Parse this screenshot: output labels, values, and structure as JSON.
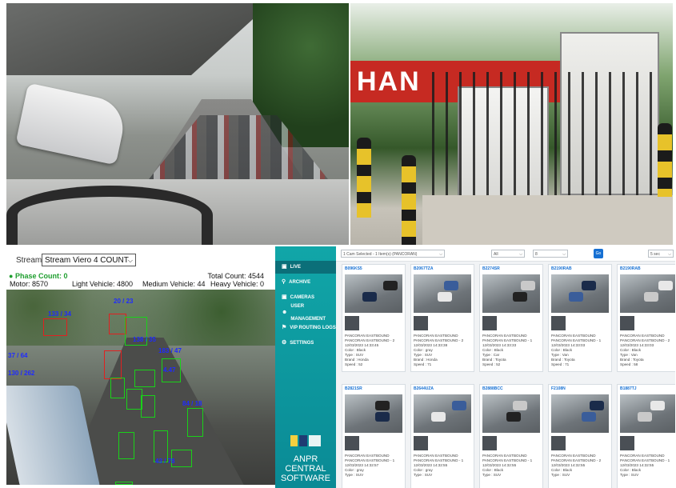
{
  "photo_top_right": {
    "banner_text": "HAN"
  },
  "counter_app": {
    "stream_label": "Stream",
    "stream_value": "Stream Viero 4 COUNT",
    "phase_count": "Phase Count: 0",
    "motor": "Motor: 8570",
    "light_vehicle": "Light Vehicle: 4800",
    "medium_vehicle": "Medium Vehicle: 44",
    "total_count": "Total Count: 4544",
    "heavy_vehicle": "Heavy Vehicle: 0",
    "detection_labels": [
      "133 / 34",
      "20 / 23",
      "138 / 35",
      "37 / 64",
      "130 / 262",
      "183 / 47",
      "4.47",
      "84 / 18",
      "43 / 78"
    ]
  },
  "anpr": {
    "nav": [
      {
        "icon": "live-icon",
        "label": "LIVE"
      },
      {
        "icon": "archive-icon",
        "label": "ARCHIVE"
      },
      {
        "icon": "camera-icon",
        "label": "CAMERAS"
      },
      {
        "icon": "user-icon",
        "label": "USER MANAGEMENT"
      },
      {
        "icon": "logs-icon",
        "label": "VIP ROUTING LOGS"
      },
      {
        "icon": "gear-icon",
        "label": "SETTINGS"
      }
    ],
    "brand_line1": "ANPR",
    "brand_line2": "CENTRAL",
    "brand_line3": "SOFTWARE",
    "filter_camera": "1 Cam Selected - 1 Item(s) (PANCORAN)",
    "filter_all": "All",
    "filter_count": "8",
    "filter_button": "Go",
    "filter_right": "5 sec",
    "cards": [
      {
        "plate": "B096KS5",
        "location": "PANCORAN EASTBOUND",
        "camera": "PANCORAN EASTBOUND - 2",
        "time": "12/03/2023 14:33:45",
        "color": "Color : Black",
        "type": "Type : SUV",
        "brand": "Brand : Honda",
        "speed": "Speed : 52"
      },
      {
        "plate": "B2067TZA",
        "location": "PANCORAN EASTBOUND",
        "camera": "PANCORAN EASTBOUND - 2",
        "time": "12/03/2023 14:33:38",
        "color": "Color : gray",
        "type": "Type : SUV",
        "brand": "Brand : Honda",
        "speed": "Speed : 71"
      },
      {
        "plate": "B2274SR",
        "location": "PANCORAN EASTBOUND",
        "camera": "PANCORAN EASTBOUND - 1",
        "time": "12/03/2023 14:33:33",
        "color": "Color : Black",
        "type": "Type : Car",
        "brand": "Brand : Toyota",
        "speed": "Speed : 52"
      },
      {
        "plate": "B2190RAB",
        "location": "PANCORAN EASTBOUND",
        "camera": "PANCORAN EASTBOUND - 1",
        "time": "12/03/2023 14:33:03",
        "color": "Color : Black",
        "type": "Type : Van",
        "brand": "Brand : Toyota",
        "speed": "Speed : 71"
      },
      {
        "plate": "B2190RAB",
        "location": "PANCORAN EASTBOUND",
        "camera": "PANCORAN EASTBOUND - 2",
        "time": "12/03/2023 14:33:03",
        "color": "Color : Black",
        "type": "Type : Van",
        "brand": "Brand : Toyota",
        "speed": "Speed : 58"
      },
      {
        "plate": "B2821SR",
        "location": "PANCORAN EASTBOUND",
        "camera": "PANCORAN EASTBOUND - 1",
        "time": "12/03/2023 14:32:57",
        "color": "Color : gray",
        "type": "Type : SUV",
        "brand": "",
        "speed": ""
      },
      {
        "plate": "B2644UZA",
        "location": "PANCORAN EASTBOUND",
        "camera": "PANCORAN EASTBOUND - 1",
        "time": "12/03/2023 14:32:55",
        "color": "Color : gray",
        "type": "Type : SUV",
        "brand": "",
        "speed": ""
      },
      {
        "plate": "B2888BCC",
        "location": "PANCORAN EASTBOUND",
        "camera": "PANCORAN EASTBOUND - 1",
        "time": "12/03/2023 14:32:55",
        "color": "Color : Black",
        "type": "Type : SUV",
        "brand": "",
        "speed": ""
      },
      {
        "plate": "F2108N",
        "location": "PANCORAN EASTBOUND",
        "camera": "PANCORAN EASTBOUND - 2",
        "time": "12/03/2023 14:32:55",
        "color": "Color : Black",
        "type": "Type : SUV",
        "brand": "",
        "speed": ""
      },
      {
        "plate": "B1887TJ",
        "location": "PANCORAN EASTBOUND",
        "camera": "PANCORAN EASTBOUND - 1",
        "time": "12/03/2023 14:32:55",
        "color": "Color : Black",
        "type": "Type : SUV",
        "brand": "",
        "speed": ""
      }
    ]
  }
}
